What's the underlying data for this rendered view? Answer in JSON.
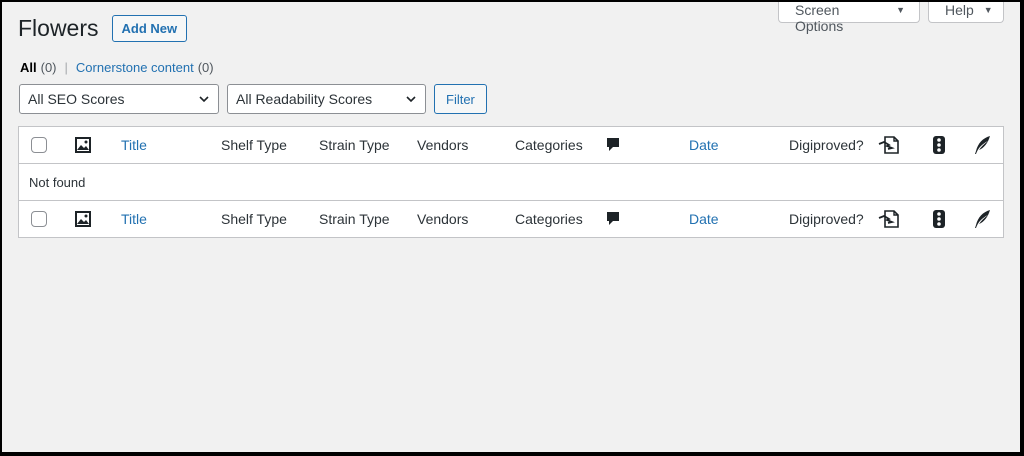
{
  "screen_meta": {
    "screen_options": "Screen Options",
    "help": "Help"
  },
  "page": {
    "title": "Flowers",
    "add_new": "Add New"
  },
  "views": {
    "all_label": "All",
    "all_count": "(0)",
    "separator": "|",
    "cornerstone_label": "Cornerstone content",
    "cornerstone_count": "(0)"
  },
  "filters": {
    "seo": "All SEO Scores",
    "readability": "All Readability Scores",
    "filter_button": "Filter"
  },
  "table": {
    "columns": {
      "title": "Title",
      "shelf_type": "Shelf Type",
      "strain_type": "Strain Type",
      "vendors": "Vendors",
      "categories": "Categories",
      "date": "Date",
      "digiproved": "Digiproved?"
    },
    "icons": [
      "image-icon",
      "comment-icon",
      "digiproved-doc-icon",
      "traffic-light-icon",
      "feather-icon"
    ],
    "empty_message": "Not found"
  }
}
